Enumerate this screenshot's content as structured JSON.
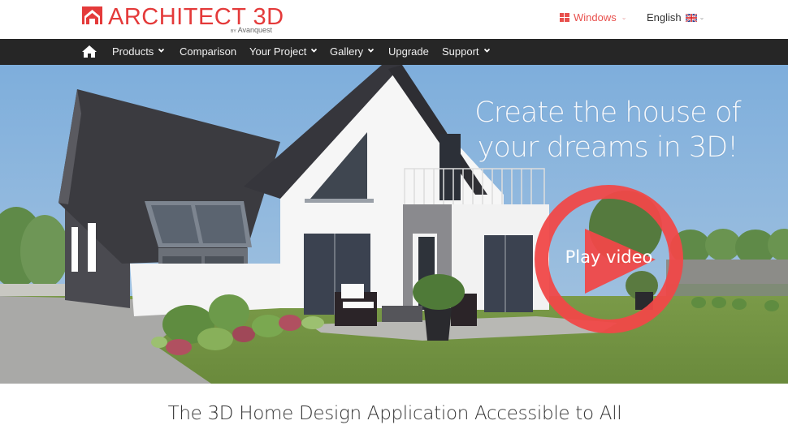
{
  "brand": {
    "name": "ARCHITECT 3D",
    "by_prefix": "BY",
    "by_company": "Avanquest",
    "color": "#e43a3a"
  },
  "header": {
    "platform": {
      "icon": "windows-icon",
      "label": "Windows",
      "color": "#e8504d"
    },
    "language": {
      "label": "English",
      "flag_icon": "uk-flag-icon"
    }
  },
  "nav": {
    "home_icon": "home-icon",
    "items": [
      {
        "label": "Products",
        "has_dropdown": true
      },
      {
        "label": "Comparison",
        "has_dropdown": false
      },
      {
        "label": "Your Project",
        "has_dropdown": true
      },
      {
        "label": "Gallery",
        "has_dropdown": true
      },
      {
        "label": "Upgrade",
        "has_dropdown": false
      },
      {
        "label": "Support",
        "has_dropdown": true
      }
    ],
    "background": "#262626"
  },
  "hero": {
    "title_line1": "Create the house of",
    "title_line2": "your dreams in 3D!",
    "play_label": "Play video",
    "play_color": "#f04848",
    "image_alt": "3D rendering of a modern white house with dark slate roof, balcony, terrace and garden"
  },
  "main": {
    "tagline": "The 3D Home Design Application Accessible to All"
  }
}
